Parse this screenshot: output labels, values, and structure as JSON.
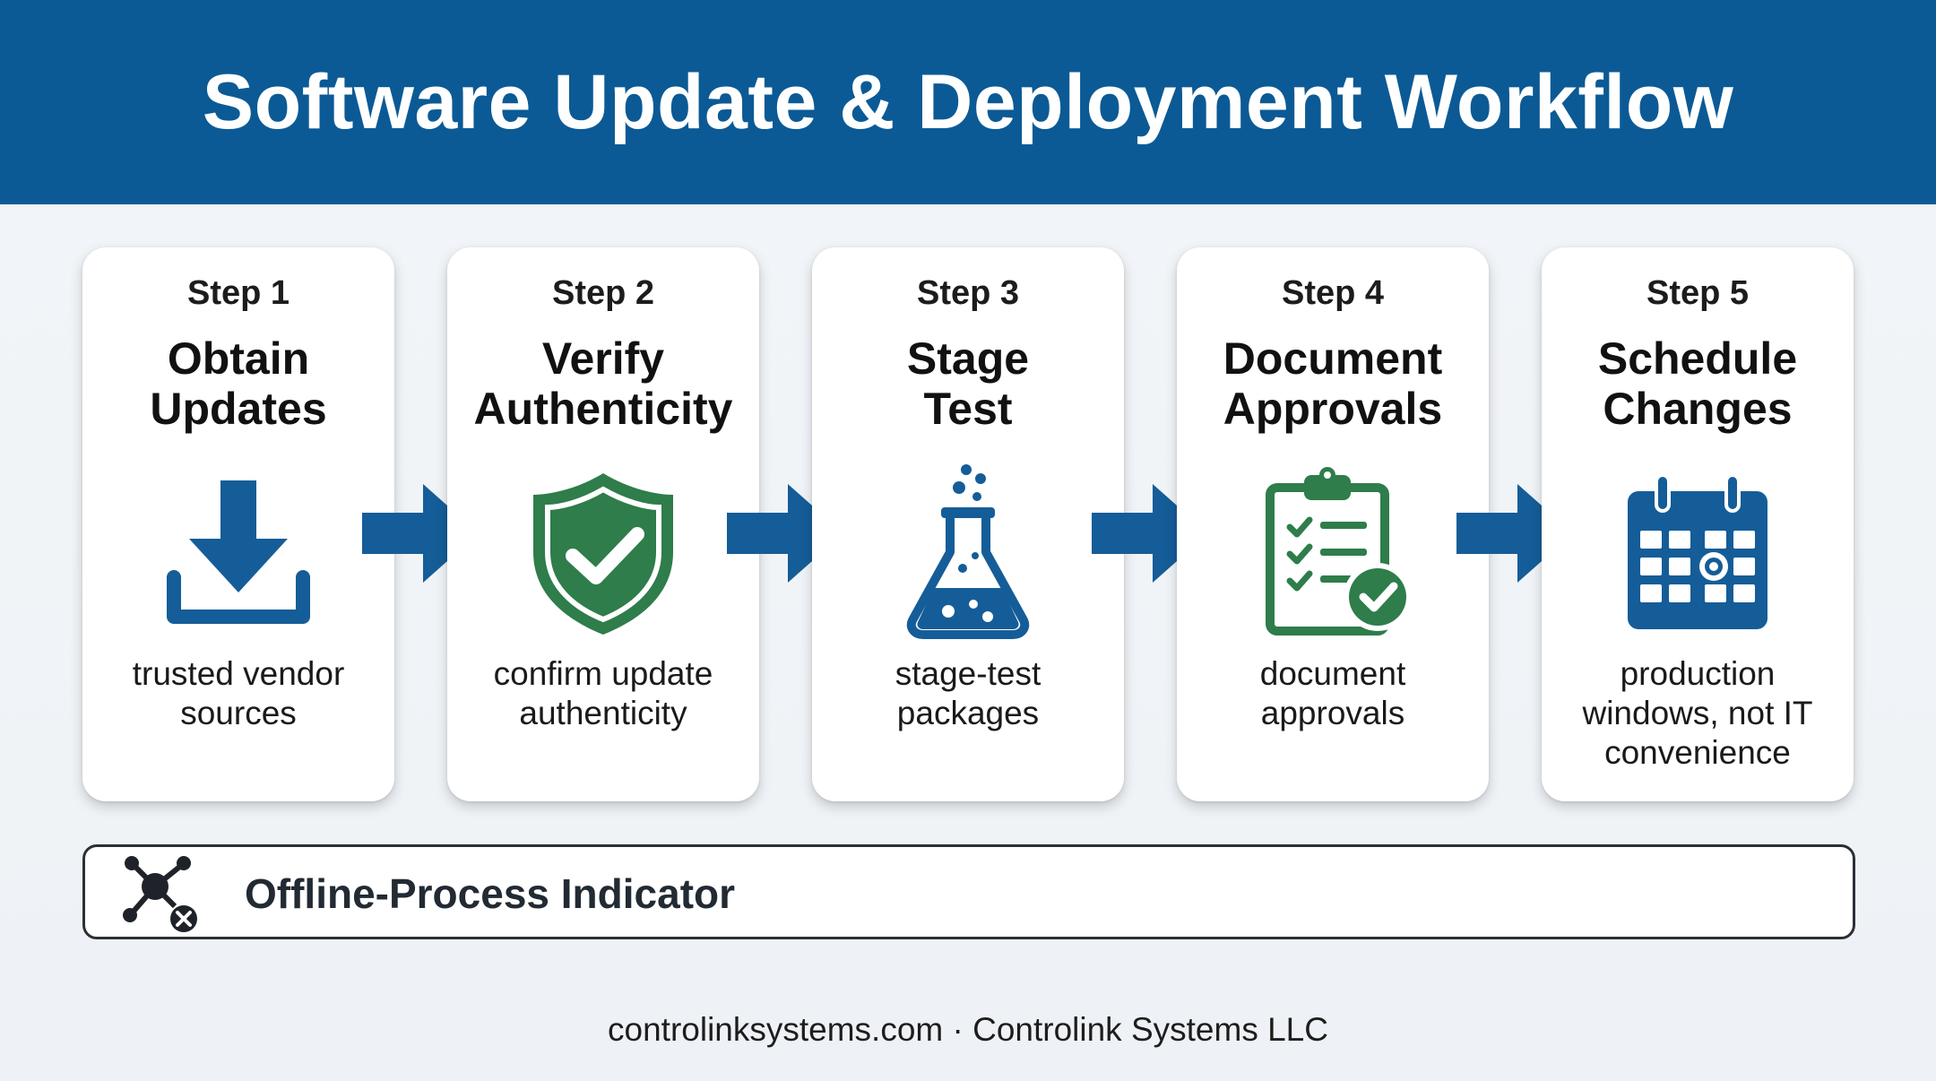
{
  "title": "Software Update & Deployment Workflow",
  "colors": {
    "banner": "#0b5a95",
    "accent_blue": "#155d98",
    "accent_green": "#2e7d4a"
  },
  "steps": [
    {
      "label": "Step 1",
      "title": [
        "Obtain",
        "Updates"
      ],
      "icon": "download-icon",
      "desc": [
        "trusted vendor",
        "sources"
      ]
    },
    {
      "label": "Step 2",
      "title": [
        "Verify",
        "Authenticity"
      ],
      "icon": "shield-check-icon",
      "desc": [
        "confirm update",
        "authenticity"
      ]
    },
    {
      "label": "Step 3",
      "title": [
        "Stage",
        "Test"
      ],
      "icon": "flask-icon",
      "desc": [
        "stage-test",
        "packages"
      ]
    },
    {
      "label": "Step 4",
      "title": [
        "Document",
        "Approvals"
      ],
      "icon": "clipboard-check-icon",
      "desc": [
        "document",
        "approvals"
      ]
    },
    {
      "label": "Step 5",
      "title": [
        "Schedule",
        "Changes"
      ],
      "icon": "calendar-icon",
      "desc": [
        "production",
        "windows, not IT",
        "convenience"
      ]
    }
  ],
  "indicator": {
    "label": "Offline-Process Indicator",
    "icon": "network-offline-icon"
  },
  "footer": "controlinksystems.com · Controlink Systems LLC"
}
